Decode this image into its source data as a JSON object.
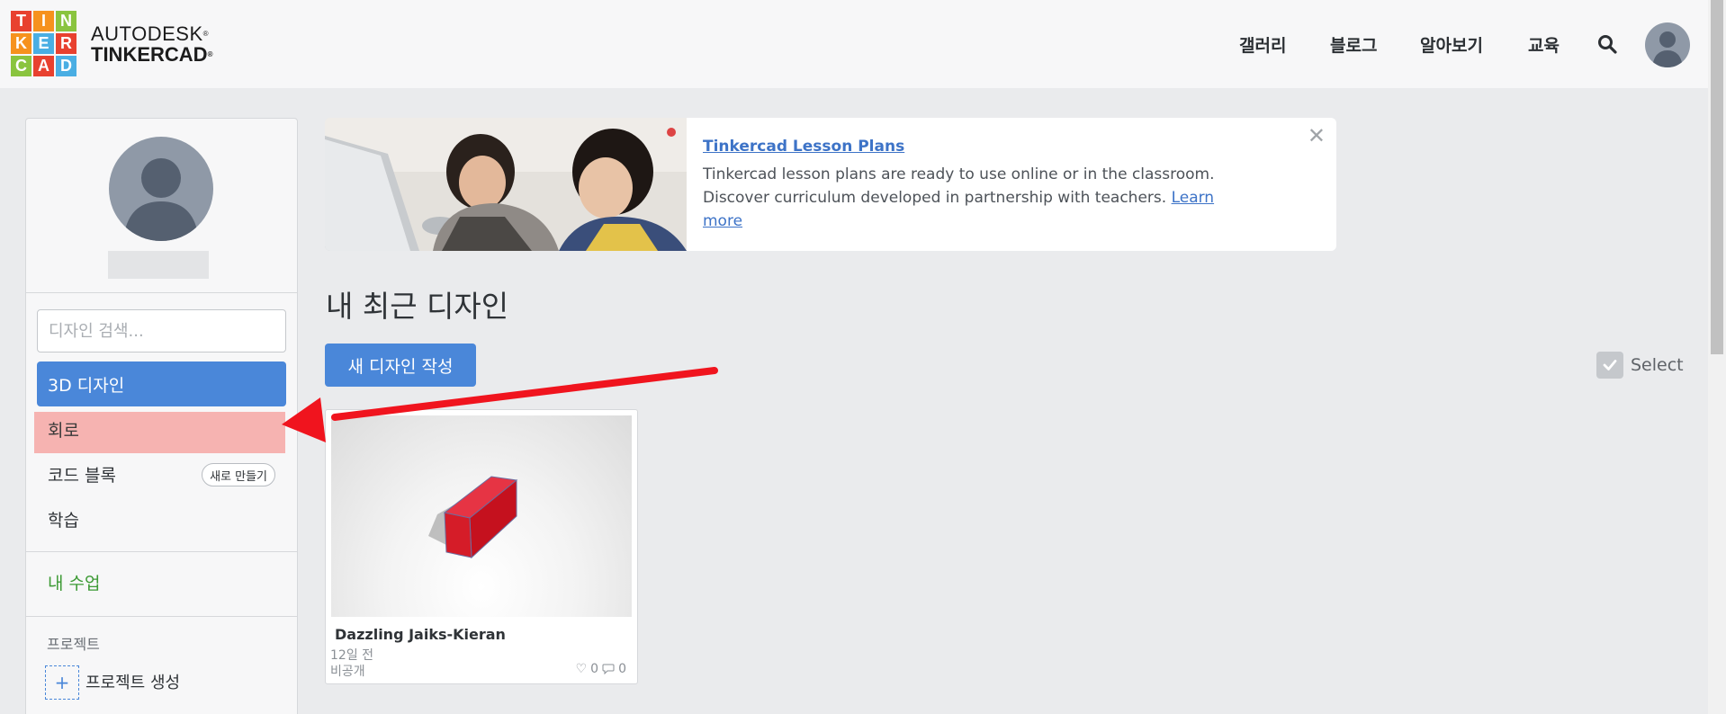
{
  "header": {
    "logo_letters": [
      "T",
      "I",
      "N",
      "K",
      "E",
      "R",
      "C",
      "A",
      "D"
    ],
    "logo_colors": [
      "#e8412f",
      "#f6921e",
      "#8ac43f",
      "#f6921e",
      "#4aaee3",
      "#e8412f",
      "#8ac43f",
      "#e8412f",
      "#4aaee3"
    ],
    "brand_top": "AUTODESK",
    "brand_bottom": "TINKERCAD",
    "nav": [
      "갤러리",
      "블로그",
      "알아보기",
      "교육"
    ],
    "icons": [
      "search-icon",
      "avatar"
    ]
  },
  "sidebar": {
    "search_placeholder": "디자인 검색...",
    "items": [
      {
        "label": "3D 디자인",
        "state": "active"
      },
      {
        "label": "회로",
        "state": "highlighted"
      },
      {
        "label": "코드 블록",
        "badge": "새로 만들기"
      },
      {
        "label": "학습"
      }
    ],
    "class_link": "내 수업",
    "projects_label": "프로젝트",
    "add_icon": "+",
    "create_project": "프로젝트 생성"
  },
  "banner": {
    "title": "Tinkercad Lesson Plans",
    "text": "Tinkercad lesson plans are ready to use online or in the classroom. Discover curriculum developed in partnership with teachers.",
    "link": "Learn more",
    "close_icon": "close-icon"
  },
  "main": {
    "section_title": "내 최근 디자인",
    "new_design_button": "새 디자인 작성",
    "select_label": "Select"
  },
  "designs": [
    {
      "title": "Dazzling Jaiks-Kieran",
      "time": "12일 전",
      "visibility": "비공개",
      "likes": "0",
      "comments": "0"
    }
  ],
  "colors": {
    "accent": "#4a87d9",
    "highlight": "#f6b3b1",
    "class_link": "#3c9a34",
    "annotation_arrow": "#f0141e"
  }
}
